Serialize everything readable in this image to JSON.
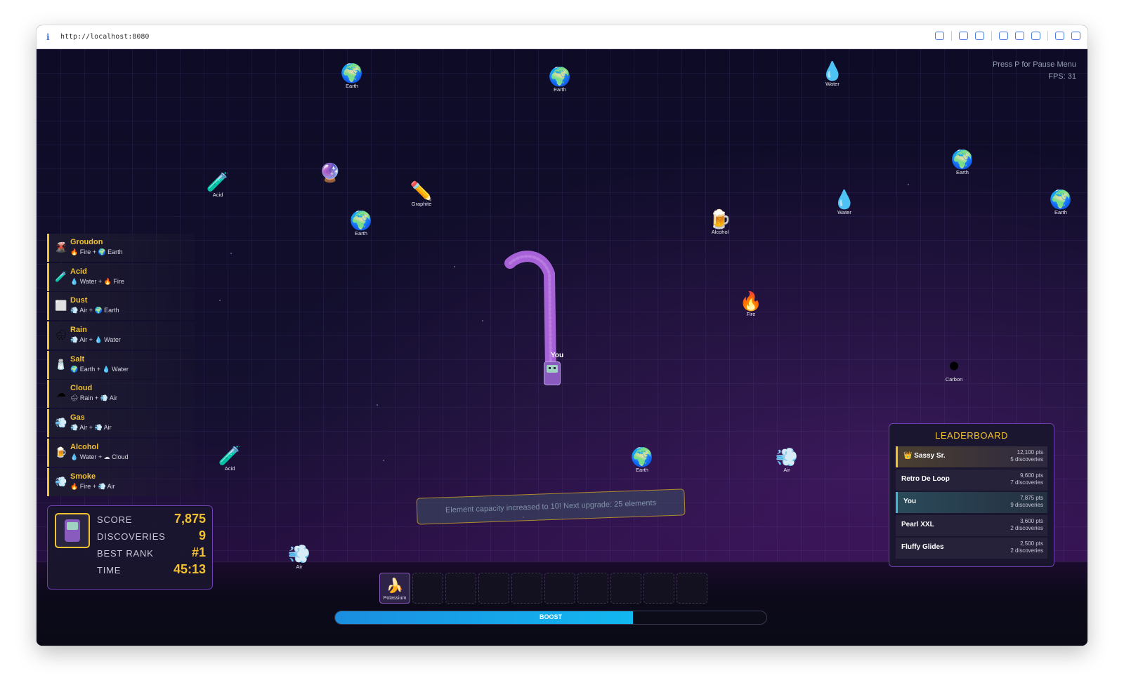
{
  "browser": {
    "url": "http://localhost:8080"
  },
  "hud": {
    "pause_hint": "Press P for Pause Menu",
    "fps": "FPS: 31"
  },
  "player": {
    "label": "You"
  },
  "pickups": [
    {
      "name": "Earth",
      "icon": "earth-icon",
      "emoji": "🌍"
    },
    {
      "name": "Earth",
      "icon": "earth-icon",
      "emoji": "🌍"
    },
    {
      "name": "Water",
      "icon": "water-drop-icon",
      "emoji": "💧"
    },
    {
      "name": "Acid",
      "icon": "test-tube-icon",
      "emoji": "🧪"
    },
    {
      "name": "",
      "icon": "potion-icon",
      "emoji": "🔮"
    },
    {
      "name": "Graphite",
      "icon": "pencil-icon",
      "emoji": "✏️"
    },
    {
      "name": "Earth",
      "icon": "earth-icon",
      "emoji": "🌍"
    },
    {
      "name": "Alcohol",
      "icon": "beer-icon",
      "emoji": "🍺"
    },
    {
      "name": "Water",
      "icon": "water-drop-icon",
      "emoji": "💧"
    },
    {
      "name": "Earth",
      "icon": "earth-icon",
      "emoji": "🌍"
    },
    {
      "name": "Earth",
      "icon": "earth-icon",
      "emoji": "🌍"
    },
    {
      "name": "Fire",
      "icon": "fire-icon",
      "emoji": "🔥"
    },
    {
      "name": "Carbon",
      "icon": "black-circle-icon",
      "emoji": "⚫"
    },
    {
      "name": "Acid",
      "icon": "test-tube-icon",
      "emoji": "🧪"
    },
    {
      "name": "Earth",
      "icon": "earth-icon",
      "emoji": "🌍"
    },
    {
      "name": "Air",
      "icon": "wind-icon",
      "emoji": "💨"
    },
    {
      "name": "Air",
      "icon": "wind-icon",
      "emoji": "💨"
    }
  ],
  "recipes": [
    {
      "name": "Groudon",
      "icon": "volcano-icon",
      "emoji": "🌋",
      "formula": "🔥 Fire + 🌍 Earth"
    },
    {
      "name": "Acid",
      "icon": "test-tube-icon",
      "emoji": "🧪",
      "formula": "💧 Water + 🔥 Fire"
    },
    {
      "name": "Dust",
      "icon": "dust-icon",
      "emoji": "⬜",
      "formula": "💨 Air + 🌍 Earth"
    },
    {
      "name": "Rain",
      "icon": "rain-cloud-icon",
      "emoji": "🌧",
      "formula": "💨 Air + 💧 Water"
    },
    {
      "name": "Salt",
      "icon": "salt-icon",
      "emoji": "🧂",
      "formula": "🌍 Earth + 💧 Water"
    },
    {
      "name": "Cloud",
      "icon": "cloud-icon",
      "emoji": "☁",
      "formula": "🌧 Rain + 💨 Air"
    },
    {
      "name": "Gas",
      "icon": "gas-icon",
      "emoji": "💨",
      "formula": "💨 Air + 💨 Air"
    },
    {
      "name": "Alcohol",
      "icon": "beer-icon",
      "emoji": "🍺",
      "formula": "💧 Water + ☁ Cloud"
    },
    {
      "name": "Smoke",
      "icon": "smoke-icon",
      "emoji": "💨",
      "formula": "🔥 Fire + 💨 Air"
    }
  ],
  "stats": {
    "score_label": "SCORE",
    "score": "7,875",
    "discoveries_label": "DISCOVERIES",
    "discoveries": "9",
    "best_rank_label": "BEST RANK",
    "best_rank": "#1",
    "time_label": "TIME",
    "time": "45:13"
  },
  "toast": "Element capacity increased to 10! Next upgrade: 25 elements",
  "leaderboard": {
    "title": "LEADERBOARD",
    "rows": [
      {
        "name": "👑 Sassy Sr.",
        "points": "12,100 pts",
        "discoveries": "5 discoveries"
      },
      {
        "name": "Retro De Loop",
        "points": "9,600 pts",
        "discoveries": "7 discoveries"
      },
      {
        "name": "You",
        "points": "7,875 pts",
        "discoveries": "9 discoveries"
      },
      {
        "name": "Pearl XXL",
        "points": "3,600 pts",
        "discoveries": "2 discoveries"
      },
      {
        "name": "Fluffy Glides",
        "points": "2,500 pts",
        "discoveries": "2 discoveries"
      }
    ]
  },
  "inventory": {
    "capacity": 10,
    "items": [
      {
        "name": "Potassium",
        "icon": "banana-icon",
        "emoji": "🍌"
      }
    ]
  },
  "boost": {
    "label": "BOOST",
    "level": 0.69
  },
  "colors": {
    "accent": "#f2c230",
    "panel_border": "#6d3fb0",
    "worm": "#a862d8",
    "boost": "#12b8f0"
  }
}
